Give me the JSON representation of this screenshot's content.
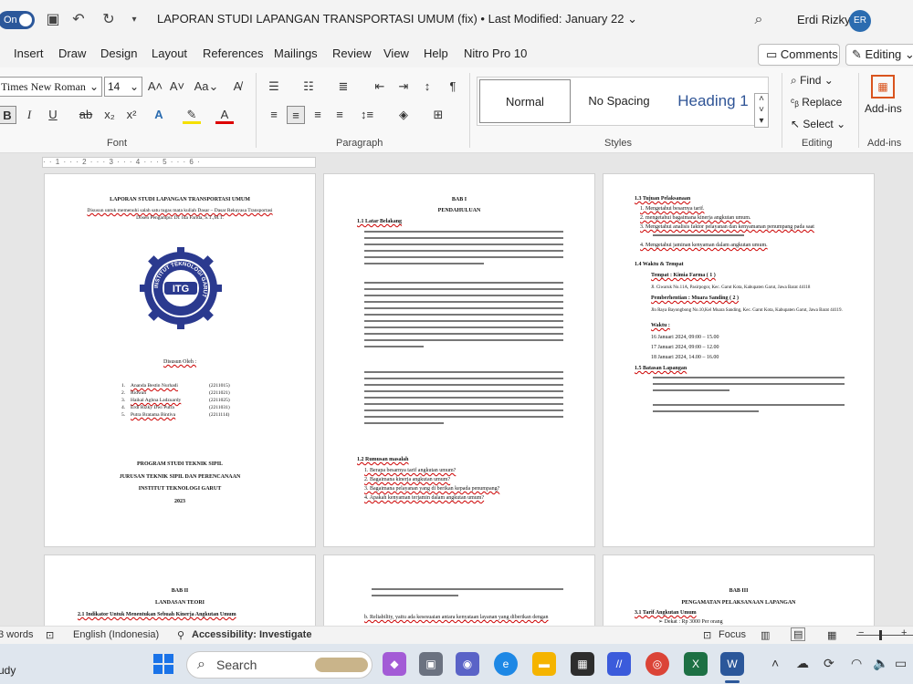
{
  "titlebar": {
    "autosave": "On",
    "document_title": "LAPORAN STUDI LAPANGAN TRANSPORTASI UMUM (fix) • Last Modified: January 22",
    "user_name": "Erdi Rizky",
    "user_initials": "ER"
  },
  "menu": {
    "tabs": [
      "Insert",
      "Draw",
      "Design",
      "Layout",
      "References",
      "Mailings",
      "Review",
      "View",
      "Help",
      "Nitro Pro 10"
    ],
    "comments": "Comments",
    "editing": "Editing"
  },
  "ribbon": {
    "font_name": "Times New Roman",
    "font_size": "14",
    "groups": [
      "Font",
      "Paragraph",
      "Styles",
      "Editing",
      "Add-ins"
    ],
    "styles": [
      "Normal",
      "No Spacing",
      "Heading 1"
    ],
    "find": "Find",
    "replace": "Replace",
    "select": "Select",
    "addins": "Add-ins"
  },
  "ruler": {
    "marks": "· · 1 · · · 2 · · · 3 · · · 4 · · · 5 · · · 6 ·"
  },
  "pages": {
    "cover": {
      "title": "LAPORAN STUDI LAPANGAN TRANSPORTASI UMUM",
      "sub1": "Disusun untuk memenuhi salah satu tugas mata kuliah Dasar – Dasar Rekayasa Transportasi",
      "sub2": "Dosen Pengampu: Dr. Ida Farida, S.T.,M.T.",
      "logo_text": "ITG",
      "logo_ring": "INSTITUT TEKNOLOGI GARUT",
      "disusun": "Disusun Oleh :",
      "members": [
        {
          "no": "1.",
          "name": "Ananda Bestin Nurhadi",
          "nim": "(2211015)"
        },
        {
          "no": "2.",
          "name": "Ridwan",
          "nim": "(2211021)"
        },
        {
          "no": "3.",
          "name": "Haikal Aghna Ladzuardy",
          "nim": "(2211025)"
        },
        {
          "no": "4.",
          "name": "Erdi Rizky Dwi Putra",
          "nim": "(2211031)"
        },
        {
          "no": "5.",
          "name": "Putra Bratama Bintiva",
          "nim": "(2211114)"
        }
      ],
      "footer": [
        "PROGRAM STUDI TEKNIK SIPIL",
        "JURUSAN TEKNIK SIPIL DAN PERENCANAAN",
        "INSTITUT TEKNOLOGI GARUT",
        "2023"
      ]
    },
    "bab1": {
      "bab": "BAB I",
      "title": "PENDAHULUAN",
      "section1": "1.1 Latar Belakang",
      "section2": "1.2 Rumusan masalah",
      "rumusan": [
        "1.  Berapa besarnya tarif angkutan umum?",
        "2.  Bagaimana kinerja angkutan umum?",
        "3.  Bagaimana pelayanan yang di berikan kepada penumpang?",
        "4.  Apakah kenyaman terjamin dalam angkutan umum?"
      ]
    },
    "tujuan": {
      "section": "1.3 Tujuan Pelaksanaan",
      "items": [
        "1.  Mengetahui besarnya tarif.",
        "2.  mengetahui bagaimana kinerja angkutan umum.",
        "3.  Mengetahui analisis faktor pelayanan dan kenyamanan penumpang pada saat",
        "4.  Mengetahui jaminan kenyaman dalam angkutan umum."
      ],
      "waktu": "1.4 Waktu & Tempat",
      "tempat": "Tempat : Kimia Farma ( 1 )",
      "tempat_addr": "Jl. Ciwaruk No.11A, Pasirpogor, Kec. Garut Kota, Kabupaten Garut, Jawa Barat 44118",
      "pemberhentian": "Pemberhentian : Muara Sanding ( 2 )",
      "pemberhentian_addr": "Jln Raya Bayongbong No.10,Kel Muara Sanding, Kec. Garut Kota, Kabupaten Garut, Jawa Barat 44119.",
      "waktu_label": "Waktu :",
      "times": [
        "16 Januari 2024, 09:00 – 15.00",
        "17 Januari 2024, 09:00 – 12.00",
        "18 Januari 2024, 14.00 – 16.00"
      ],
      "batasan": "1.5 Batasan Lapangan"
    },
    "bab2": {
      "bab": "BAB II",
      "title": "LANDASAN TEORI",
      "item": "2.1    Indikator Untuk Menentukan Sebuah Kinerja Angkutan Umum"
    },
    "mid": {
      "reliability": "b.   Reliability, yaitu ada kesesuaian antara kenyataan layanan yang diberikan dengan"
    },
    "bab3": {
      "bab": "BAB III",
      "title": "PENGAMATAN PELAKSANAAN LAPANGAN",
      "section": "3.1 Tarif Angkutan Umum",
      "item": "➢  Dekat : Rp 3000 Per orang"
    }
  },
  "statusbar": {
    "words": "3 words",
    "language": "English (Indonesia)",
    "accessibility": "Accessibility: Investigate",
    "focus": "Focus"
  },
  "taskbar": {
    "left_label": "udy",
    "search": "Search"
  }
}
